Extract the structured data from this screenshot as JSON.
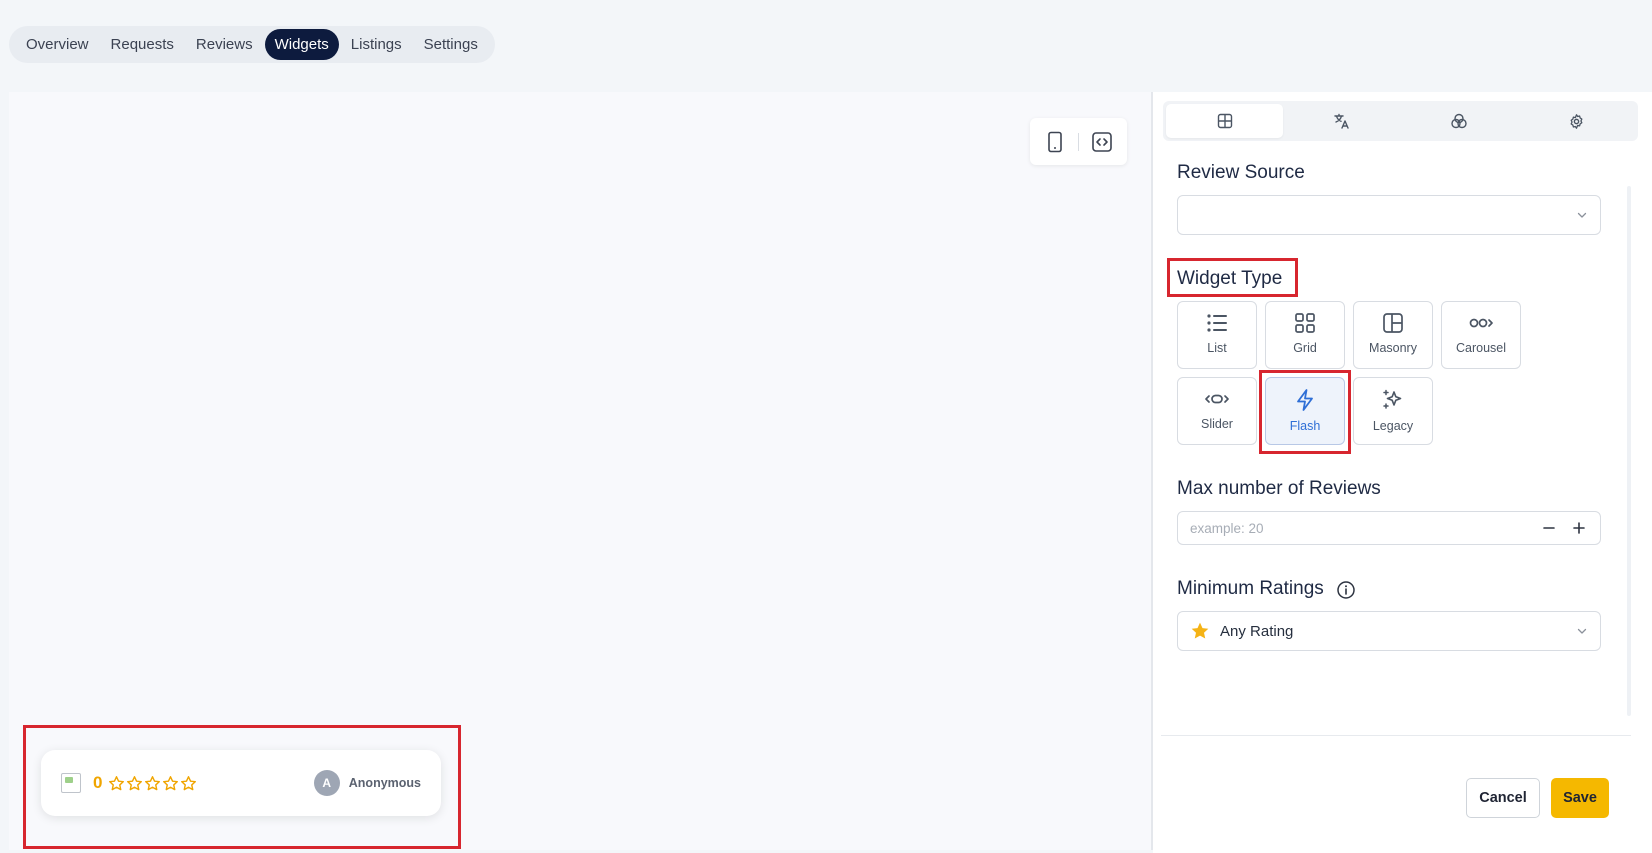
{
  "nav": {
    "items": [
      "Overview",
      "Requests",
      "Reviews",
      "Widgets",
      "Listings",
      "Settings"
    ],
    "active": "Widgets"
  },
  "preview_toolbar": {
    "icons": [
      "mobile-device-icon",
      "code-embed-icon"
    ]
  },
  "flash_widget": {
    "rating_value": "0",
    "stars_filled": 0,
    "stars_total": 5,
    "avatar_initial": "A",
    "author": "Anonymous"
  },
  "panel": {
    "tabs": [
      {
        "icon": "layout-grid-icon",
        "active": true
      },
      {
        "icon": "translate-icon",
        "active": false
      },
      {
        "icon": "color-palette-icon",
        "active": false
      },
      {
        "icon": "settings-gear-icon",
        "active": false
      }
    ],
    "review_source": {
      "label": "Review Source",
      "value": ""
    },
    "widget_type": {
      "label": "Widget Type",
      "options": [
        "List",
        "Grid",
        "Masonry",
        "Carousel",
        "Slider",
        "Flash",
        "Legacy"
      ],
      "selected": "Flash"
    },
    "max_reviews": {
      "label": "Max number of Reviews",
      "placeholder": "example: 20",
      "value": ""
    },
    "min_ratings": {
      "label": "Minimum Ratings",
      "value": "Any Rating"
    },
    "cancel_label": "Cancel",
    "save_label": "Save"
  },
  "colors": {
    "nav_active": "#0d1b3e",
    "accent_yellow": "#f5b800",
    "selected_blue": "#2f6fd6",
    "highlight_red": "#d7262f"
  }
}
